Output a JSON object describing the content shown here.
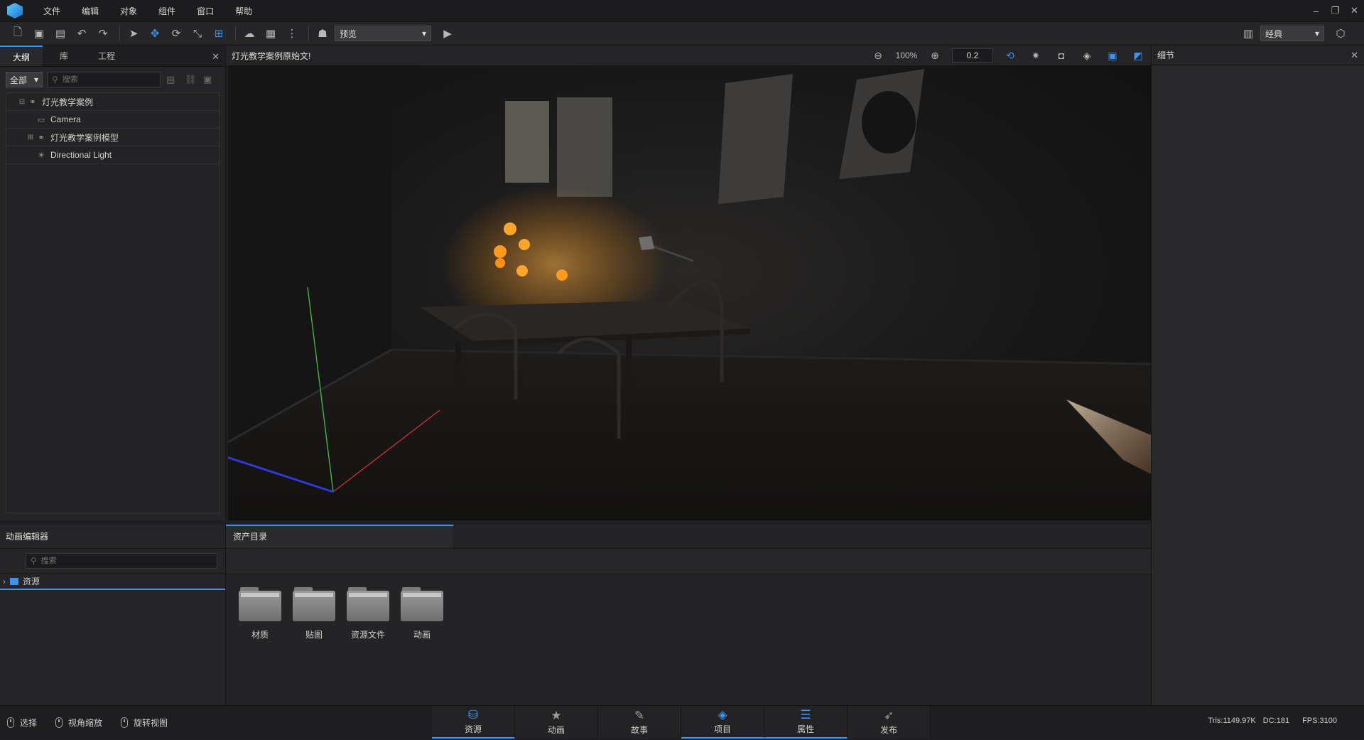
{
  "menu": {
    "items": [
      "文件",
      "编辑",
      "对象",
      "组件",
      "窗口",
      "帮助"
    ]
  },
  "window_controls": {
    "minimize": "–",
    "restore": "❐",
    "close": "✕"
  },
  "toolbar": {
    "preview_select": "预览",
    "layout_select": "经典"
  },
  "left_panel": {
    "tabs": [
      "大纲",
      "库",
      "工程"
    ],
    "filter_select": "全部",
    "search_placeholder": "搜索",
    "tree": [
      {
        "label": "灯光教学案例",
        "icon": "group-icon",
        "expander": "⊟"
      },
      {
        "label": "Camera",
        "icon": "camera-icon",
        "expander": ""
      },
      {
        "label": "灯光教学案例模型",
        "icon": "group-icon",
        "expander": "⊞"
      },
      {
        "label": "Directional Light",
        "icon": "sun-icon",
        "expander": ""
      }
    ]
  },
  "viewport": {
    "title": "灯光教学案例原始文!",
    "zoom": "100%",
    "speed_value": "0.2"
  },
  "right_panel": {
    "title": "细节"
  },
  "anim_panel": {
    "title": "动画编辑器",
    "search_placeholder": "搜索",
    "root_label": "资源"
  },
  "asset_panel": {
    "tab": "资产目录",
    "folders": [
      "材质",
      "贴图",
      "资源文件",
      "动画"
    ]
  },
  "status": {
    "select": "选择",
    "zoom": "视角缩放",
    "rotate": "旋转视图",
    "tabs": [
      "资源",
      "动画",
      "故事",
      "项目",
      "属性",
      "发布"
    ],
    "tris": "Tris:1149.97K",
    "dc": "DC:181",
    "fps": "FPS:3100"
  },
  "colors": {
    "accent": "#3a94f2",
    "background": "#202022"
  }
}
